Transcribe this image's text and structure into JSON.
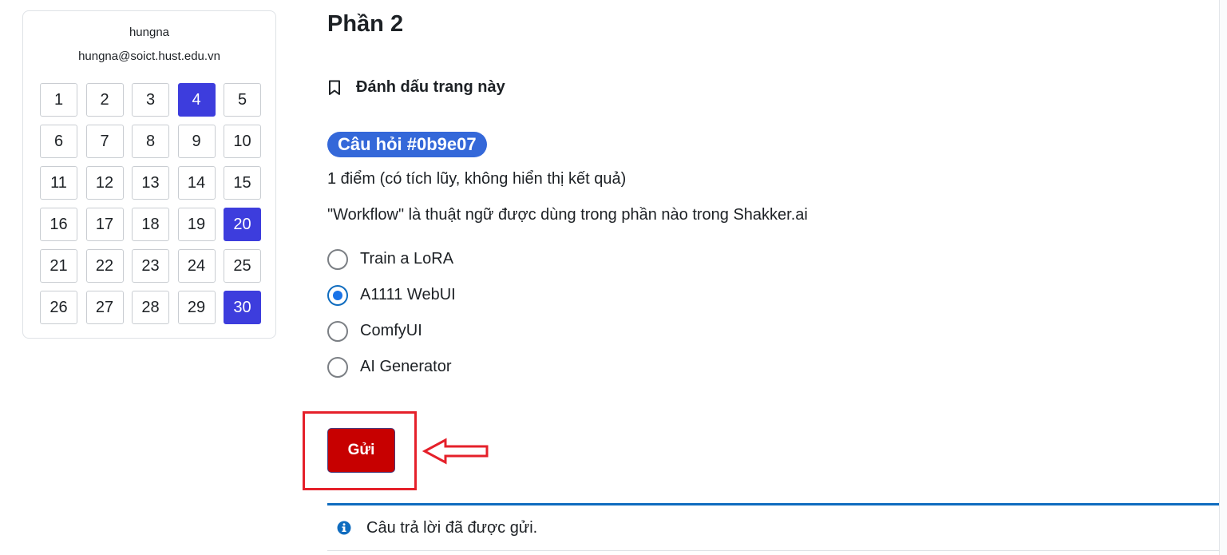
{
  "user": {
    "name": "hungna",
    "email": "hungna@soict.hust.edu.vn"
  },
  "quiz_nav": {
    "buttons": [
      {
        "label": "1",
        "state": "default"
      },
      {
        "label": "2",
        "state": "default"
      },
      {
        "label": "3",
        "state": "default"
      },
      {
        "label": "4",
        "state": "answered"
      },
      {
        "label": "5",
        "state": "default"
      },
      {
        "label": "6",
        "state": "default"
      },
      {
        "label": "7",
        "state": "default"
      },
      {
        "label": "8",
        "state": "default"
      },
      {
        "label": "9",
        "state": "default"
      },
      {
        "label": "10",
        "state": "default"
      },
      {
        "label": "11",
        "state": "default"
      },
      {
        "label": "12",
        "state": "default"
      },
      {
        "label": "13",
        "state": "default"
      },
      {
        "label": "14",
        "state": "default"
      },
      {
        "label": "15",
        "state": "default"
      },
      {
        "label": "16",
        "state": "default"
      },
      {
        "label": "17",
        "state": "default"
      },
      {
        "label": "18",
        "state": "default"
      },
      {
        "label": "19",
        "state": "default"
      },
      {
        "label": "20",
        "state": "answered"
      },
      {
        "label": "21",
        "state": "default"
      },
      {
        "label": "22",
        "state": "default"
      },
      {
        "label": "23",
        "state": "default"
      },
      {
        "label": "24",
        "state": "default"
      },
      {
        "label": "25",
        "state": "default"
      },
      {
        "label": "26",
        "state": "default"
      },
      {
        "label": "27",
        "state": "default"
      },
      {
        "label": "28",
        "state": "default"
      },
      {
        "label": "29",
        "state": "default"
      },
      {
        "label": "30",
        "state": "answered"
      }
    ]
  },
  "main": {
    "section_title": "Phần 2",
    "flag_label": "Đánh dấu trang này",
    "question_id": "Câu hỏi #0b9e07",
    "grade_info": "1 điểm (có tích lũy, không hiển thị kết quả)",
    "question_text": "\"Workflow\" là thuật ngữ được dùng trong phần nào trong Shakker.ai",
    "options": [
      {
        "label": "Train a LoRA",
        "selected": false
      },
      {
        "label": "A1111 WebUI",
        "selected": true
      },
      {
        "label": "ComfyUI",
        "selected": false
      },
      {
        "label": "AI Generator",
        "selected": false
      }
    ],
    "submit_label": "Gửi",
    "feedback_text": "Câu trả lời đã được gửi."
  },
  "colors": {
    "answered_nav": "#3d3ddd",
    "badge": "#3468d9",
    "submit": "#c70000",
    "highlight": "#e5202a",
    "feedback_border": "#0f6cbf"
  }
}
